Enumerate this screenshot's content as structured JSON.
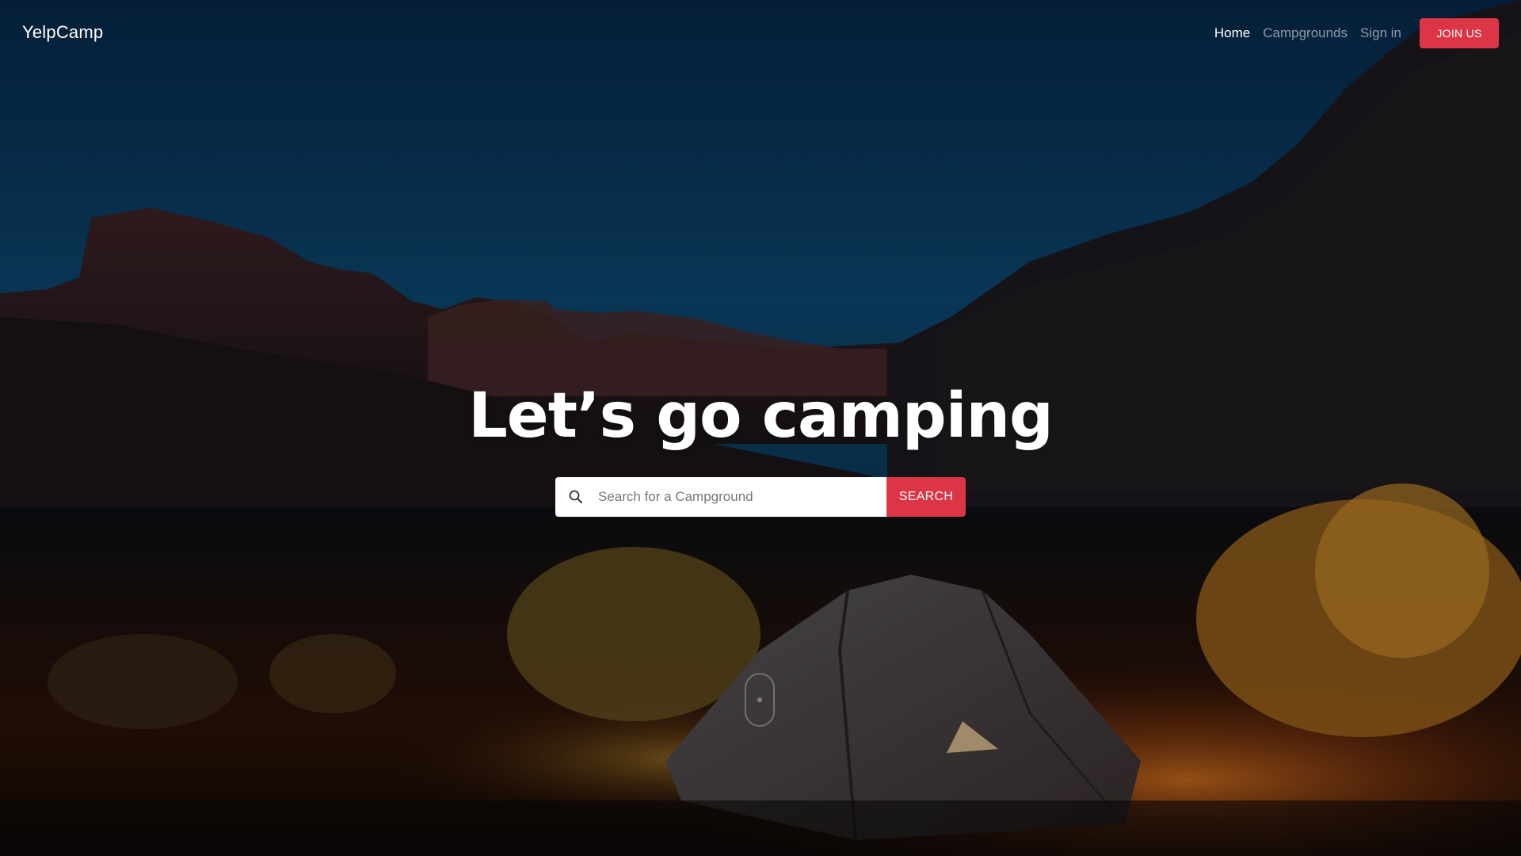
{
  "brand": {
    "name": "YelpCamp"
  },
  "nav": {
    "links": [
      {
        "label": "Home",
        "active": true
      },
      {
        "label": "Campgrounds",
        "active": false
      },
      {
        "label": "Sign in",
        "active": false
      }
    ],
    "join_label": "JOIN US"
  },
  "hero": {
    "title": "Let’s go camping",
    "background_icon": "campsite-photo-icon"
  },
  "search": {
    "placeholder": "Search for a Campground",
    "value": "",
    "button_label": "SEARCH",
    "icon": "search-icon"
  },
  "scroll_indicator": {
    "icon": "mouse-scroll-icon"
  },
  "colors": {
    "accent": "#dc3545",
    "text_light": "#ffffff",
    "nav_muted": "rgba(255,255,255,0.55)"
  }
}
